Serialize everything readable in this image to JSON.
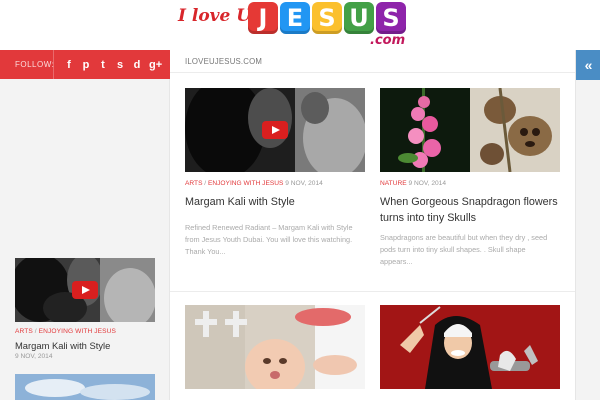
{
  "header": {
    "logo_script": "I love U",
    "logo_letters": [
      "J",
      "E",
      "S",
      "U",
      "S"
    ],
    "logo_colors": [
      "#e53935",
      "#2196f3",
      "#fbc02d",
      "#43a047",
      "#8e24aa"
    ],
    "logo_suffix": ".com"
  },
  "sidebar": {
    "follow_label": "FOLLOW:",
    "social_icons": [
      "facebook-icon",
      "pinterest-icon",
      "twitter-icon",
      "stumbleupon-icon",
      "delicious-icon",
      "googleplus-icon"
    ],
    "social_glyphs": [
      "f",
      "p",
      "t",
      "s",
      "d",
      "g+"
    ],
    "post": {
      "cat1": "ARTS",
      "sep": " / ",
      "cat2": "ENJOYING WITH JESUS",
      "title": "Margam Kali with Style",
      "date": "9 NOV, 2014"
    }
  },
  "main": {
    "breadcrumb": "ILOVEUJESUS.COM",
    "cards": [
      {
        "cat1": "ARTS",
        "sep": " / ",
        "cat2": "ENJOYING WITH JESUS",
        "date": "9 NOV, 2014",
        "title": "Margam Kali with Style",
        "excerpt": "Refined Renewed Radiant – Margam Kali with Style from Jesus Youth Dubai. You will love this watching. Thank You..."
      },
      {
        "cat1": "NATURE",
        "date": "9 NOV, 2014",
        "title": "When Gorgeous Snapdragon flowers turns into tiny Skulls",
        "excerpt": "Snapdragons are beautiful but when they dry , seed pods turn into tiny skull shapes. . Skull shape appears..."
      }
    ]
  },
  "colors": {
    "accent": "#e2393b",
    "strip_blue": "#4a8dc5"
  }
}
